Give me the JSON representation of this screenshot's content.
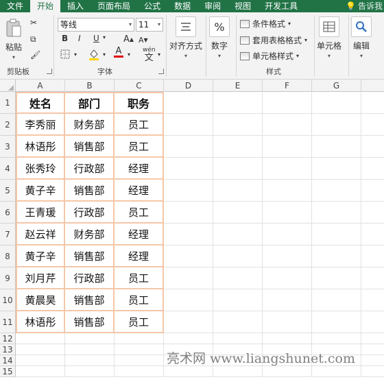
{
  "menu": {
    "tabs": [
      "文件",
      "开始",
      "插入",
      "页面布局",
      "公式",
      "数据",
      "审阅",
      "视图",
      "开发工具"
    ],
    "active_index": 1,
    "tell_me": "告诉我"
  },
  "ribbon": {
    "clipboard": {
      "paste_label": "粘贴",
      "group_label": "剪贴板"
    },
    "font": {
      "font_name": "等线",
      "font_size": "11",
      "bold": "B",
      "italic": "I",
      "underline": "U",
      "grow": "A",
      "shrink": "A",
      "font_color_letter": "A",
      "phonetic": "wén",
      "group_label": "字体"
    },
    "alignment": {
      "label": "对齐方式"
    },
    "number": {
      "label": "数字",
      "symbol": "%"
    },
    "styles": {
      "conditional": "条件格式",
      "table": "套用表格格式",
      "cell_styles": "单元格样式",
      "group_label": "样式"
    },
    "cells": {
      "label": "单元格"
    },
    "editing": {
      "label": "编辑"
    }
  },
  "grid": {
    "columns": [
      "A",
      "B",
      "C",
      "D",
      "E",
      "F",
      "G"
    ],
    "rows": [
      "1",
      "2",
      "3",
      "4",
      "5",
      "6",
      "7",
      "8",
      "9",
      "10",
      "11",
      "12",
      "13",
      "14",
      "15"
    ],
    "headers": [
      "姓名",
      "部门",
      "职务"
    ],
    "data": [
      [
        "李秀丽",
        "财务部",
        "员工"
      ],
      [
        "林语彤",
        "销售部",
        "员工"
      ],
      [
        "张秀玲",
        "行政部",
        "经理"
      ],
      [
        "黄子辛",
        "销售部",
        "经理"
      ],
      [
        "王青瑗",
        "行政部",
        "员工"
      ],
      [
        "赵云祥",
        "财务部",
        "经理"
      ],
      [
        "黄子辛",
        "销售部",
        "经理"
      ],
      [
        "刘月芹",
        "行政部",
        "员工"
      ],
      [
        "黄晨昊",
        "销售部",
        "员工"
      ],
      [
        "林语彤",
        "销售部",
        "员工"
      ]
    ]
  },
  "watermark": "亮术网 www.liangshunet.com",
  "colors": {
    "brand": "#217346",
    "table_border": "#f4c7a8"
  }
}
